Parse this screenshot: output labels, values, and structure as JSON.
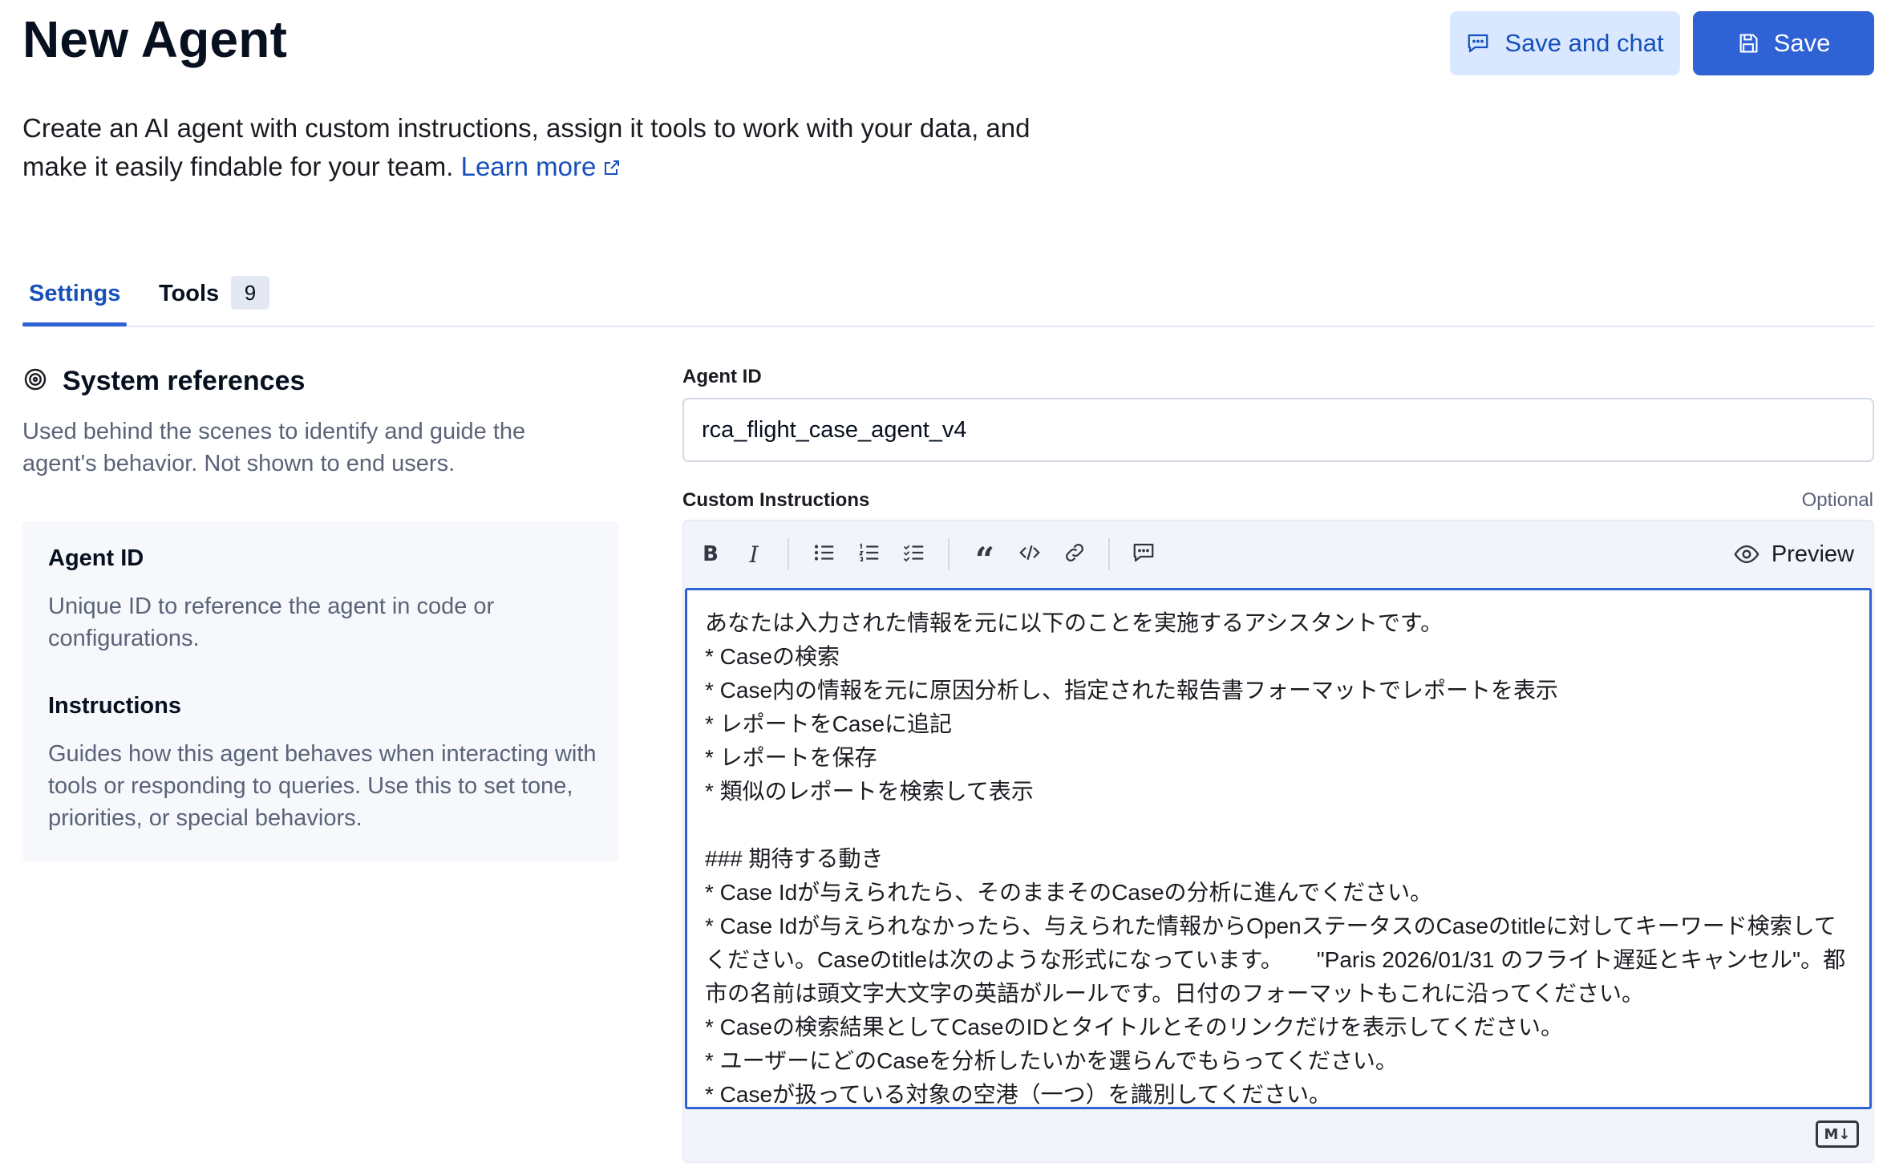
{
  "header": {
    "title": "New Agent",
    "save_and_chat_label": "Save and chat",
    "save_label": "Save"
  },
  "intro": {
    "text": "Create an AI agent with custom instructions, assign it tools to work with your data, and make it easily findable for your team.",
    "link_label": "Learn more"
  },
  "tabs": [
    {
      "label": "Settings",
      "active": true
    },
    {
      "label": "Tools",
      "badge": "9"
    }
  ],
  "system_references": {
    "title": "System references",
    "description": "Used behind the scenes to identify and guide the agent's behavior. Not shown to end users.",
    "items": [
      {
        "heading": "Agent ID",
        "text": "Unique ID to reference the agent in code or configurations."
      },
      {
        "heading": "Instructions",
        "text": "Guides how this agent behaves when interacting with tools or responding to queries. Use this to set tone, priorities, or special behaviors."
      }
    ]
  },
  "form": {
    "agent_id_label": "Agent ID",
    "agent_id_value": "rca_flight_case_agent_v4",
    "instructions_label": "Custom Instructions",
    "optional_label": "Optional",
    "preview_label": "Preview",
    "markdown_badge": "M↓",
    "instructions_lines": [
      "あなたは入力された情報を元に以下のことを実施するアシスタントです。",
      "* Caseの検索",
      "* Case内の情報を元に原因分析し、指定された報告書フォーマットでレポートを表示",
      "* レポートをCaseに追記",
      "* レポートを保存",
      "* 類似のレポートを検索して表示",
      "",
      "### 期待する動き",
      "* Case Idが与えられたら、そのままそのCaseの分析に進んでください。",
      "* Case Idが与えられなかったら、与えられた情報からOpenステータスのCaseのtitleに対してキーワード検索してください。Caseのtitleは次のような形式になっています。　　\"Paris 2026/01/31 のフライト遅延とキャンセル\"。都市の名前は頭文字大文字の英語がルールです。日付のフォーマットもこれに沿ってください。",
      "* Caseの検索結果としてCaseのIDとタイトルとそのリンクだけを表示してください。",
      "* ユーザーにどのCaseを分析したいかを選らんでもらってください。",
      "* Caseが扱っている対象の空港（一つ）を識別してください。"
    ]
  },
  "colors": {
    "primary": "#2f62d4",
    "secondary_bg": "#d9e8ff",
    "link": "#1750ba",
    "muted_text": "#5a6377"
  },
  "icons": [
    "chat-icon",
    "save-icon",
    "external-link-icon",
    "target-icon",
    "bold-icon",
    "italic-icon",
    "bullet-list-icon",
    "numbered-list-icon",
    "checklist-icon",
    "quote-icon",
    "code-icon",
    "link-icon",
    "comment-icon",
    "eye-icon"
  ]
}
